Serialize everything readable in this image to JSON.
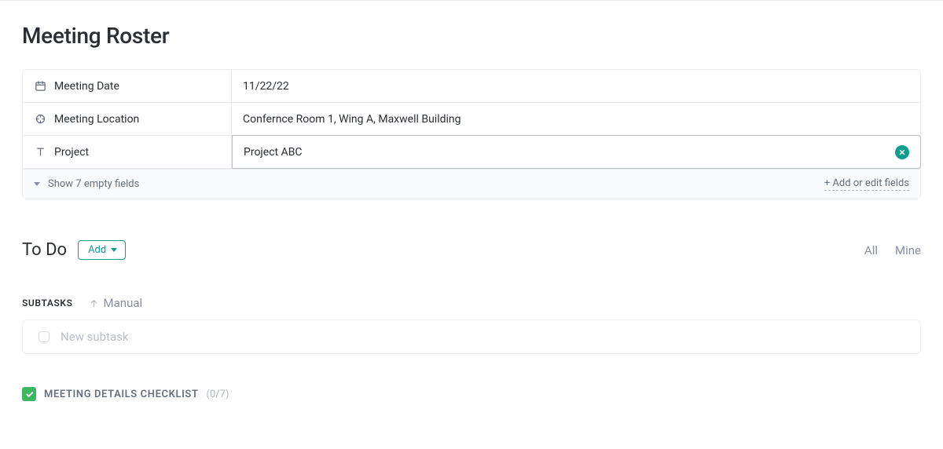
{
  "title": "Meeting Roster",
  "fields": {
    "meeting_date": {
      "label": "Meeting Date",
      "value": "11/22/22"
    },
    "meeting_location": {
      "label": "Meeting Location",
      "value": "Confernce Room 1, Wing A, Maxwell Building"
    },
    "project": {
      "label": "Project",
      "value": "Project ABC"
    }
  },
  "fields_footer": {
    "show_empty": "Show 7 empty fields",
    "add_edit": "+ Add or edit fields"
  },
  "todo": {
    "heading": "To Do",
    "add_label": "Add",
    "filters": {
      "all": "All",
      "mine": "Mine"
    }
  },
  "subtasks": {
    "label": "SUBTASKS",
    "sort_mode": "Manual",
    "new_placeholder": "New subtask"
  },
  "checklist": {
    "title": "MEETING DETAILS CHECKLIST",
    "count": "(0/7)"
  }
}
